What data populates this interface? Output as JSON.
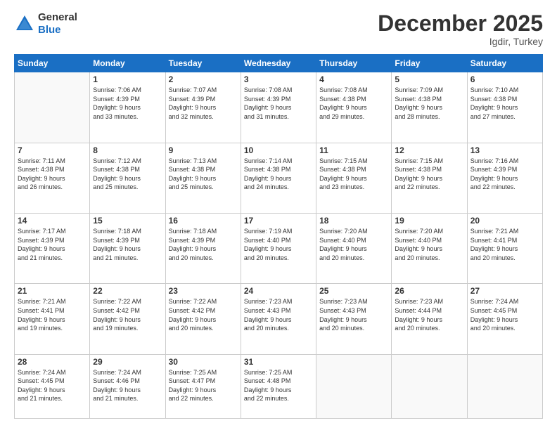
{
  "header": {
    "logo_general": "General",
    "logo_blue": "Blue",
    "month_title": "December 2025",
    "location": "Igdir, Turkey"
  },
  "days_of_week": [
    "Sunday",
    "Monday",
    "Tuesday",
    "Wednesday",
    "Thursday",
    "Friday",
    "Saturday"
  ],
  "weeks": [
    [
      {
        "day": "",
        "lines": []
      },
      {
        "day": "1",
        "lines": [
          "Sunrise: 7:06 AM",
          "Sunset: 4:39 PM",
          "Daylight: 9 hours",
          "and 33 minutes."
        ]
      },
      {
        "day": "2",
        "lines": [
          "Sunrise: 7:07 AM",
          "Sunset: 4:39 PM",
          "Daylight: 9 hours",
          "and 32 minutes."
        ]
      },
      {
        "day": "3",
        "lines": [
          "Sunrise: 7:08 AM",
          "Sunset: 4:39 PM",
          "Daylight: 9 hours",
          "and 31 minutes."
        ]
      },
      {
        "day": "4",
        "lines": [
          "Sunrise: 7:08 AM",
          "Sunset: 4:38 PM",
          "Daylight: 9 hours",
          "and 29 minutes."
        ]
      },
      {
        "day": "5",
        "lines": [
          "Sunrise: 7:09 AM",
          "Sunset: 4:38 PM",
          "Daylight: 9 hours",
          "and 28 minutes."
        ]
      },
      {
        "day": "6",
        "lines": [
          "Sunrise: 7:10 AM",
          "Sunset: 4:38 PM",
          "Daylight: 9 hours",
          "and 27 minutes."
        ]
      }
    ],
    [
      {
        "day": "7",
        "lines": [
          "Sunrise: 7:11 AM",
          "Sunset: 4:38 PM",
          "Daylight: 9 hours",
          "and 26 minutes."
        ]
      },
      {
        "day": "8",
        "lines": [
          "Sunrise: 7:12 AM",
          "Sunset: 4:38 PM",
          "Daylight: 9 hours",
          "and 25 minutes."
        ]
      },
      {
        "day": "9",
        "lines": [
          "Sunrise: 7:13 AM",
          "Sunset: 4:38 PM",
          "Daylight: 9 hours",
          "and 25 minutes."
        ]
      },
      {
        "day": "10",
        "lines": [
          "Sunrise: 7:14 AM",
          "Sunset: 4:38 PM",
          "Daylight: 9 hours",
          "and 24 minutes."
        ]
      },
      {
        "day": "11",
        "lines": [
          "Sunrise: 7:15 AM",
          "Sunset: 4:38 PM",
          "Daylight: 9 hours",
          "and 23 minutes."
        ]
      },
      {
        "day": "12",
        "lines": [
          "Sunrise: 7:15 AM",
          "Sunset: 4:38 PM",
          "Daylight: 9 hours",
          "and 22 minutes."
        ]
      },
      {
        "day": "13",
        "lines": [
          "Sunrise: 7:16 AM",
          "Sunset: 4:39 PM",
          "Daylight: 9 hours",
          "and 22 minutes."
        ]
      }
    ],
    [
      {
        "day": "14",
        "lines": [
          "Sunrise: 7:17 AM",
          "Sunset: 4:39 PM",
          "Daylight: 9 hours",
          "and 21 minutes."
        ]
      },
      {
        "day": "15",
        "lines": [
          "Sunrise: 7:18 AM",
          "Sunset: 4:39 PM",
          "Daylight: 9 hours",
          "and 21 minutes."
        ]
      },
      {
        "day": "16",
        "lines": [
          "Sunrise: 7:18 AM",
          "Sunset: 4:39 PM",
          "Daylight: 9 hours",
          "and 20 minutes."
        ]
      },
      {
        "day": "17",
        "lines": [
          "Sunrise: 7:19 AM",
          "Sunset: 4:40 PM",
          "Daylight: 9 hours",
          "and 20 minutes."
        ]
      },
      {
        "day": "18",
        "lines": [
          "Sunrise: 7:20 AM",
          "Sunset: 4:40 PM",
          "Daylight: 9 hours",
          "and 20 minutes."
        ]
      },
      {
        "day": "19",
        "lines": [
          "Sunrise: 7:20 AM",
          "Sunset: 4:40 PM",
          "Daylight: 9 hours",
          "and 20 minutes."
        ]
      },
      {
        "day": "20",
        "lines": [
          "Sunrise: 7:21 AM",
          "Sunset: 4:41 PM",
          "Daylight: 9 hours",
          "and 20 minutes."
        ]
      }
    ],
    [
      {
        "day": "21",
        "lines": [
          "Sunrise: 7:21 AM",
          "Sunset: 4:41 PM",
          "Daylight: 9 hours",
          "and 19 minutes."
        ]
      },
      {
        "day": "22",
        "lines": [
          "Sunrise: 7:22 AM",
          "Sunset: 4:42 PM",
          "Daylight: 9 hours",
          "and 19 minutes."
        ]
      },
      {
        "day": "23",
        "lines": [
          "Sunrise: 7:22 AM",
          "Sunset: 4:42 PM",
          "Daylight: 9 hours",
          "and 20 minutes."
        ]
      },
      {
        "day": "24",
        "lines": [
          "Sunrise: 7:23 AM",
          "Sunset: 4:43 PM",
          "Daylight: 9 hours",
          "and 20 minutes."
        ]
      },
      {
        "day": "25",
        "lines": [
          "Sunrise: 7:23 AM",
          "Sunset: 4:43 PM",
          "Daylight: 9 hours",
          "and 20 minutes."
        ]
      },
      {
        "day": "26",
        "lines": [
          "Sunrise: 7:23 AM",
          "Sunset: 4:44 PM",
          "Daylight: 9 hours",
          "and 20 minutes."
        ]
      },
      {
        "day": "27",
        "lines": [
          "Sunrise: 7:24 AM",
          "Sunset: 4:45 PM",
          "Daylight: 9 hours",
          "and 20 minutes."
        ]
      }
    ],
    [
      {
        "day": "28",
        "lines": [
          "Sunrise: 7:24 AM",
          "Sunset: 4:45 PM",
          "Daylight: 9 hours",
          "and 21 minutes."
        ]
      },
      {
        "day": "29",
        "lines": [
          "Sunrise: 7:24 AM",
          "Sunset: 4:46 PM",
          "Daylight: 9 hours",
          "and 21 minutes."
        ]
      },
      {
        "day": "30",
        "lines": [
          "Sunrise: 7:25 AM",
          "Sunset: 4:47 PM",
          "Daylight: 9 hours",
          "and 22 minutes."
        ]
      },
      {
        "day": "31",
        "lines": [
          "Sunrise: 7:25 AM",
          "Sunset: 4:48 PM",
          "Daylight: 9 hours",
          "and 22 minutes."
        ]
      },
      {
        "day": "",
        "lines": []
      },
      {
        "day": "",
        "lines": []
      },
      {
        "day": "",
        "lines": []
      }
    ]
  ]
}
